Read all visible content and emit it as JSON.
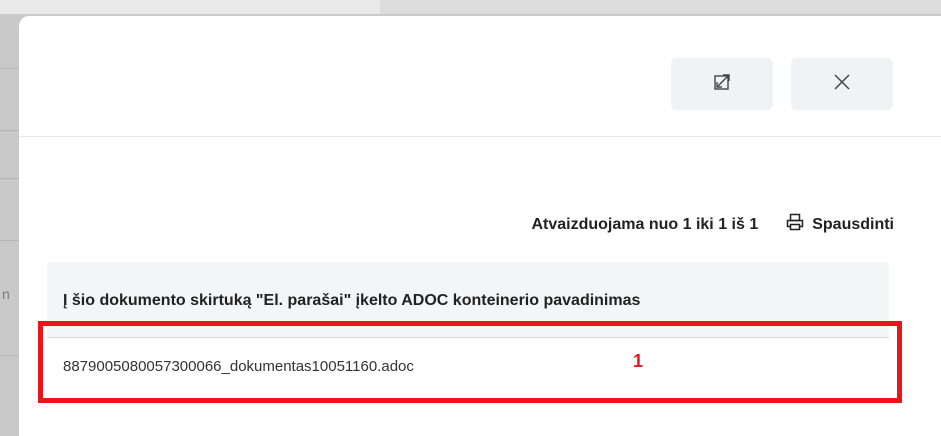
{
  "backdrop": {
    "partial_char": "n"
  },
  "header": {
    "expand_button_label": "",
    "close_button_label": ""
  },
  "toolbar": {
    "range_text": "Atvaizduojama nuo 1 iki 1 iš 1",
    "print_label": "Spausdinti"
  },
  "table": {
    "column_header": "Į šio dokumento skirtuką \"El. parašai\" įkelto ADOC konteinerio pavadinimas",
    "rows": [
      {
        "file_name": "8879005080057300066_dokumentas10051160.adoc"
      }
    ]
  },
  "annotation": {
    "marker": "1",
    "color": "#e8161b"
  },
  "icons": [
    "expand-icon",
    "close-icon",
    "printer-icon"
  ]
}
